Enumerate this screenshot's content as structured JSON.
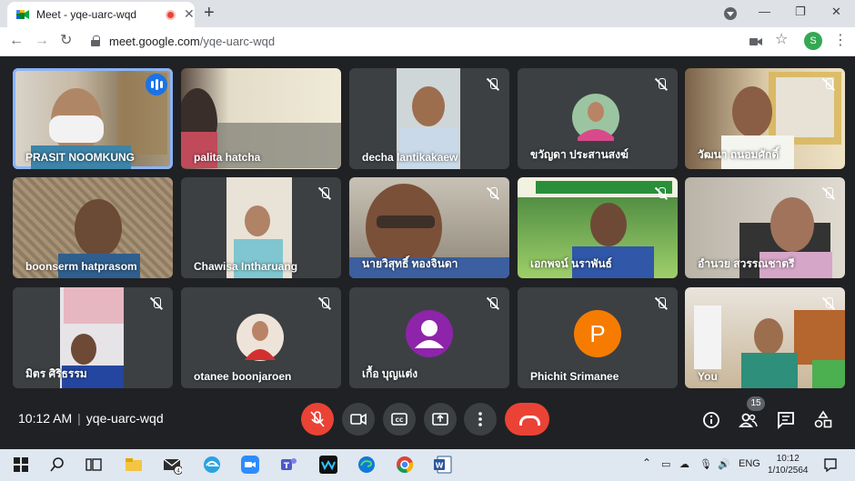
{
  "browser": {
    "tab_title": "Meet - yqe-uarc-wqd",
    "url_host": "meet.google.com",
    "url_path": "/yqe-uarc-wqd",
    "profile_initial": "S"
  },
  "participants": [
    {
      "name": "PRASIT NOOMKUNG",
      "mic": "speaking",
      "tile": "video"
    },
    {
      "name": "palita hatcha",
      "mic": "on",
      "tile": "video"
    },
    {
      "name": "decha lantikakaew",
      "mic": "muted",
      "tile": "video"
    },
    {
      "name": "ขวัญดา ประสานสงฆ์",
      "mic": "muted",
      "tile": "photo"
    },
    {
      "name": "วัฒนา ถนอมศักดิ์",
      "mic": "muted",
      "tile": "video"
    },
    {
      "name": "boonserm hatprasom",
      "mic": "on",
      "tile": "video"
    },
    {
      "name": "Chawisa Intharuang",
      "mic": "muted",
      "tile": "video"
    },
    {
      "name": "นายวิสุทธิ์ ทองจินดา",
      "mic": "muted",
      "tile": "video"
    },
    {
      "name": "เอกพจน์ นราพันธ์",
      "mic": "muted",
      "tile": "video"
    },
    {
      "name": "อำนวย สวรรณชาตรี",
      "mic": "muted",
      "tile": "video"
    },
    {
      "name": "มิตร ศิริธรรม",
      "mic": "muted",
      "tile": "video"
    },
    {
      "name": "otanee boonjaroen",
      "mic": "muted",
      "tile": "photo"
    },
    {
      "name": "เกื้อ บุญแต่ง",
      "mic": "muted",
      "tile": "avatar",
      "avatar_color": "#8e24aa"
    },
    {
      "name": "Phichit Srimanee",
      "mic": "muted",
      "tile": "letter",
      "letter": "P",
      "avatar_color": "#f57c00"
    },
    {
      "name": "You",
      "mic": "muted",
      "tile": "video"
    }
  ],
  "controls": {
    "time": "10:12 AM",
    "meeting_code": "yqe-uarc-wqd",
    "people_count": "15"
  },
  "taskbar": {
    "language": "ENG",
    "clock_time": "10:12",
    "clock_date": "1/10/2564"
  },
  "colors": {
    "meet_bg": "#202124",
    "tile_bg": "#3c4043",
    "danger": "#ea4335",
    "active_speaker": "#8ab4f8"
  }
}
